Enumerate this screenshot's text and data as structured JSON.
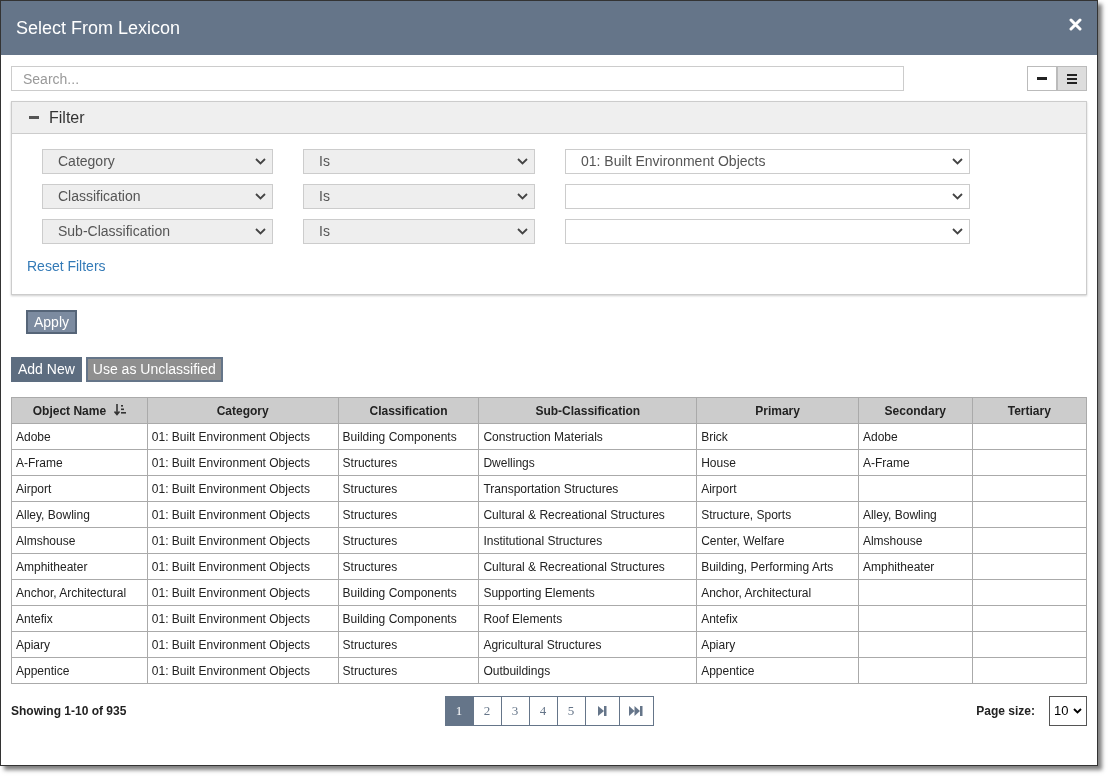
{
  "window": {
    "title": "Select From Lexicon"
  },
  "search": {
    "placeholder": "Search..."
  },
  "view_toggle": [
    {
      "kind": "compact",
      "selected": false
    },
    {
      "kind": "list",
      "selected": true
    }
  ],
  "filter": {
    "title": "Filter",
    "expanded": true,
    "rows": [
      {
        "field": "Category",
        "operator": "Is",
        "value": "01: Built Environment Objects"
      },
      {
        "field": "Classification",
        "operator": "Is",
        "value": ""
      },
      {
        "field": "Sub-Classification",
        "operator": "Is",
        "value": ""
      }
    ],
    "reset_link": "Reset Filters"
  },
  "apply_button": "Apply",
  "actions": [
    {
      "label": "Add New",
      "disabled": false
    },
    {
      "label": "Use as Unclassified",
      "disabled": true
    }
  ],
  "table": {
    "columns": [
      {
        "label": "Object Name",
        "sorted": true
      },
      {
        "label": "Category",
        "sorted": false
      },
      {
        "label": "Classification",
        "sorted": false
      },
      {
        "label": "Sub-Classification",
        "sorted": false
      },
      {
        "label": "Primary",
        "sorted": false
      },
      {
        "label": "Secondary",
        "sorted": false
      },
      {
        "label": "Tertiary",
        "sorted": false
      }
    ],
    "rows": [
      [
        "Adobe",
        "01: Built Environment Objects",
        "Building Components",
        "Construction Materials",
        "Brick",
        "Adobe",
        ""
      ],
      [
        "A-Frame",
        "01: Built Environment Objects",
        "Structures",
        "Dwellings",
        "House",
        "A-Frame",
        ""
      ],
      [
        "Airport",
        "01: Built Environment Objects",
        "Structures",
        "Transportation Structures",
        "Airport",
        "",
        ""
      ],
      [
        "Alley, Bowling",
        "01: Built Environment Objects",
        "Structures",
        "Cultural & Recreational Structures",
        "Structure, Sports",
        "Alley, Bowling",
        ""
      ],
      [
        "Almshouse",
        "01: Built Environment Objects",
        "Structures",
        "Institutional Structures",
        "Center, Welfare",
        "Almshouse",
        ""
      ],
      [
        "Amphitheater",
        "01: Built Environment Objects",
        "Structures",
        "Cultural & Recreational Structures",
        "Building, Performing Arts",
        "Amphitheater",
        ""
      ],
      [
        "Anchor, Architectural",
        "01: Built Environment Objects",
        "Building Components",
        "Supporting Elements",
        "Anchor, Architectural",
        "",
        ""
      ],
      [
        "Antefix",
        "01: Built Environment Objects",
        "Building Components",
        "Roof Elements",
        "Antefix",
        "",
        ""
      ],
      [
        "Apiary",
        "01: Built Environment Objects",
        "Structures",
        "Agricultural Structures",
        "Apiary",
        "",
        ""
      ],
      [
        "Appentice",
        "01: Built Environment Objects",
        "Structures",
        "Outbuildings",
        "Appentice",
        "",
        ""
      ]
    ]
  },
  "footer": {
    "showing": "Showing 1-10 of 935",
    "pages": [
      {
        "label": "1",
        "selected": true
      },
      {
        "label": "2",
        "selected": false
      },
      {
        "label": "3",
        "selected": false
      },
      {
        "label": "4",
        "selected": false
      },
      {
        "label": "5",
        "selected": false
      }
    ],
    "nav": [
      {
        "kind": "next"
      },
      {
        "kind": "last"
      }
    ],
    "page_size_label": "Page size:",
    "page_size": "10"
  }
}
